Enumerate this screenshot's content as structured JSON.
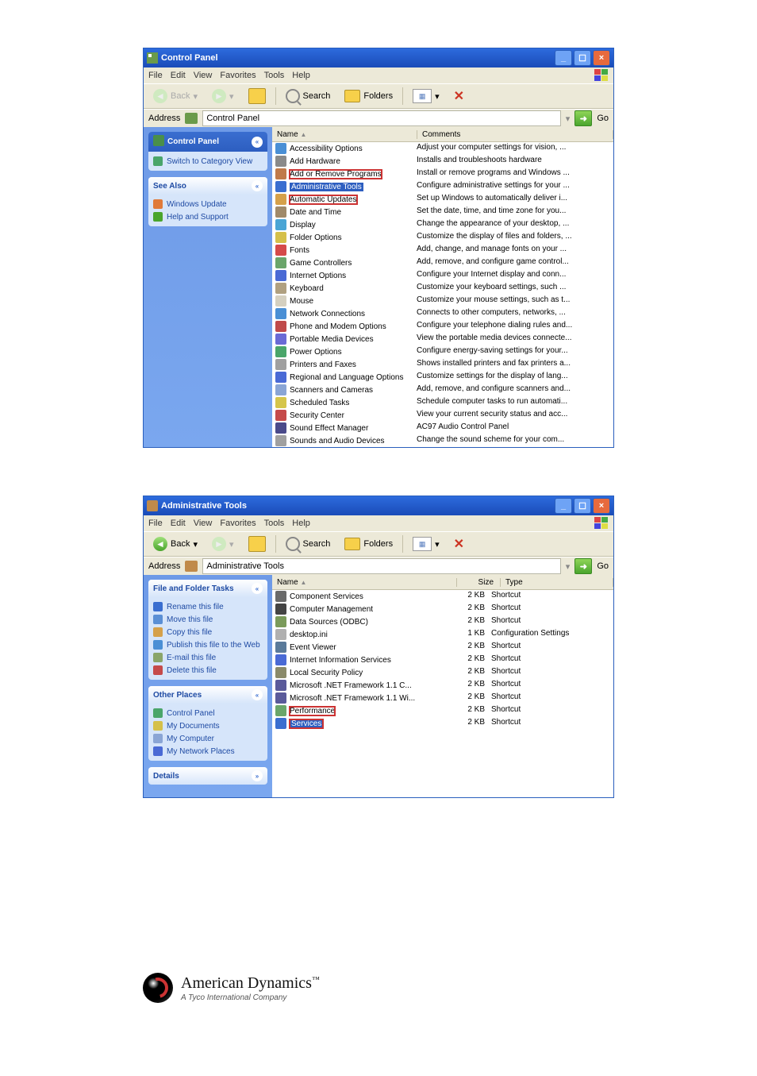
{
  "win1": {
    "title": "Control Panel",
    "menubar": [
      "File",
      "Edit",
      "View",
      "Favorites",
      "Tools",
      "Help"
    ],
    "toolbar": {
      "back": "Back",
      "search": "Search",
      "folders": "Folders"
    },
    "address_label": "Address",
    "address_value": "Control Panel",
    "go": "Go",
    "cols": {
      "name": "Name",
      "comments": "Comments",
      "sortmark": "▲"
    },
    "side": {
      "cp_title": "Control Panel",
      "switch": "Switch to Category View",
      "see_also": "See Also",
      "see_items": [
        {
          "ic": "#e07a3a",
          "label": "Windows Update"
        },
        {
          "ic": "#4aa52d",
          "label": "Help and Support"
        }
      ]
    },
    "items": [
      {
        "ic": "#4a8fd5",
        "name": "Accessibility Options",
        "c": "Adjust your computer settings for vision, ..."
      },
      {
        "ic": "#8a8a8a",
        "name": "Add Hardware",
        "c": "Installs and troubleshoots hardware"
      },
      {
        "ic": "#c07a4a",
        "name": "Add or Remove Programs",
        "c": "Install or remove programs and Windows ...",
        "ring": true
      },
      {
        "ic": "#3a6ed0",
        "name": "Administrative Tools",
        "c": "Configure administrative settings for your ...",
        "sel": true
      },
      {
        "ic": "#d5a04a",
        "name": "Automatic Updates",
        "c": "Set up Windows to automatically deliver i...",
        "ring": true
      },
      {
        "ic": "#a08a6a",
        "name": "Date and Time",
        "c": "Set the date, time, and time zone for you..."
      },
      {
        "ic": "#4aa5d5",
        "name": "Display",
        "c": "Change the appearance of your desktop, ..."
      },
      {
        "ic": "#d5c04a",
        "name": "Folder Options",
        "c": "Customize the display of files and folders, ..."
      },
      {
        "ic": "#d54a4a",
        "name": "Fonts",
        "c": "Add, change, and manage fonts on your ..."
      },
      {
        "ic": "#6aa56a",
        "name": "Game Controllers",
        "c": "Add, remove, and configure game control..."
      },
      {
        "ic": "#4a6ad5",
        "name": "Internet Options",
        "c": "Configure your Internet display and conn..."
      },
      {
        "ic": "#b0a080",
        "name": "Keyboard",
        "c": "Customize your keyboard settings, such ..."
      },
      {
        "ic": "#d5d0c0",
        "name": "Mouse",
        "c": "Customize your mouse settings, such as t..."
      },
      {
        "ic": "#4a8fd5",
        "name": "Network Connections",
        "c": "Connects to other computers, networks, ..."
      },
      {
        "ic": "#c04a4a",
        "name": "Phone and Modem Options",
        "c": "Configure your telephone dialing rules and..."
      },
      {
        "ic": "#6a6ad5",
        "name": "Portable Media Devices",
        "c": "View the portable media devices connecte..."
      },
      {
        "ic": "#4aa56a",
        "name": "Power Options",
        "c": "Configure energy-saving settings for your..."
      },
      {
        "ic": "#a0a0a0",
        "name": "Printers and Faxes",
        "c": "Shows installed printers and fax printers a..."
      },
      {
        "ic": "#4a6ad5",
        "name": "Regional and Language Options",
        "c": "Customize settings for the display of lang..."
      },
      {
        "ic": "#8aa5d5",
        "name": "Scanners and Cameras",
        "c": "Add, remove, and configure scanners and..."
      },
      {
        "ic": "#d5c54a",
        "name": "Scheduled Tasks",
        "c": "Schedule computer tasks to run automati..."
      },
      {
        "ic": "#c54a4a",
        "name": "Security Center",
        "c": "View your current security status and acc..."
      },
      {
        "ic": "#4a4a8a",
        "name": "Sound Effect Manager",
        "c": "AC97 Audio Control Panel"
      },
      {
        "ic": "#a0a0a0",
        "name": "Sounds and Audio Devices",
        "c": "Change the sound scheme for your com..."
      }
    ]
  },
  "win2": {
    "title": "Administrative Tools",
    "menubar": [
      "File",
      "Edit",
      "View",
      "Favorites",
      "Tools",
      "Help"
    ],
    "toolbar": {
      "back": "Back",
      "search": "Search",
      "folders": "Folders"
    },
    "address_label": "Address",
    "address_value": "Administrative Tools",
    "go": "Go",
    "cols": {
      "name": "Name",
      "size": "Size",
      "type": "Type",
      "sortmark": "▲"
    },
    "side": {
      "tasks_title": "File and Folder Tasks",
      "tasks": [
        {
          "ic": "#3a6ed0",
          "label": "Rename this file"
        },
        {
          "ic": "#5a8fd5",
          "label": "Move this file"
        },
        {
          "ic": "#d5a04a",
          "label": "Copy this file"
        },
        {
          "ic": "#4a8fd5",
          "label": "Publish this file to the Web"
        },
        {
          "ic": "#8aa56a",
          "label": "E-mail this file"
        },
        {
          "ic": "#c54a4a",
          "label": "Delete this file"
        }
      ],
      "other_title": "Other Places",
      "other": [
        {
          "ic": "#4aa56a",
          "label": "Control Panel"
        },
        {
          "ic": "#d5c04a",
          "label": "My Documents"
        },
        {
          "ic": "#8aa5d5",
          "label": "My Computer"
        },
        {
          "ic": "#4a6ad5",
          "label": "My Network Places"
        }
      ],
      "details_title": "Details"
    },
    "items": [
      {
        "ic": "#6a6a6a",
        "name": "Component Services",
        "size": "2 KB",
        "type": "Shortcut"
      },
      {
        "ic": "#444",
        "name": "Computer Management",
        "size": "2 KB",
        "type": "Shortcut"
      },
      {
        "ic": "#7a9a5a",
        "name": "Data Sources (ODBC)",
        "size": "2 KB",
        "type": "Shortcut"
      },
      {
        "ic": "#b0b0b0",
        "name": "desktop.ini",
        "size": "1 KB",
        "type": "Configuration Settings"
      },
      {
        "ic": "#5a7a9a",
        "name": "Event Viewer",
        "size": "2 KB",
        "type": "Shortcut"
      },
      {
        "ic": "#4a6ad5",
        "name": "Internet Information Services",
        "size": "2 KB",
        "type": "Shortcut"
      },
      {
        "ic": "#8a8a6a",
        "name": "Local Security Policy",
        "size": "2 KB",
        "type": "Shortcut"
      },
      {
        "ic": "#5a5a9a",
        "name": "Microsoft .NET Framework 1.1 C...",
        "size": "2 KB",
        "type": "Shortcut"
      },
      {
        "ic": "#5a5a9a",
        "name": "Microsoft .NET Framework 1.1 Wi...",
        "size": "2 KB",
        "type": "Shortcut"
      },
      {
        "ic": "#6aa56a",
        "name": "Performance",
        "size": "2 KB",
        "type": "Shortcut",
        "ring": true
      },
      {
        "ic": "#3a6ed0",
        "name": "Services",
        "size": "2 KB",
        "type": "Shortcut",
        "sel": true,
        "ring": true
      }
    ]
  },
  "brand": {
    "name": "American Dynamics",
    "tm": "™",
    "tag": "A Tyco International Company"
  }
}
